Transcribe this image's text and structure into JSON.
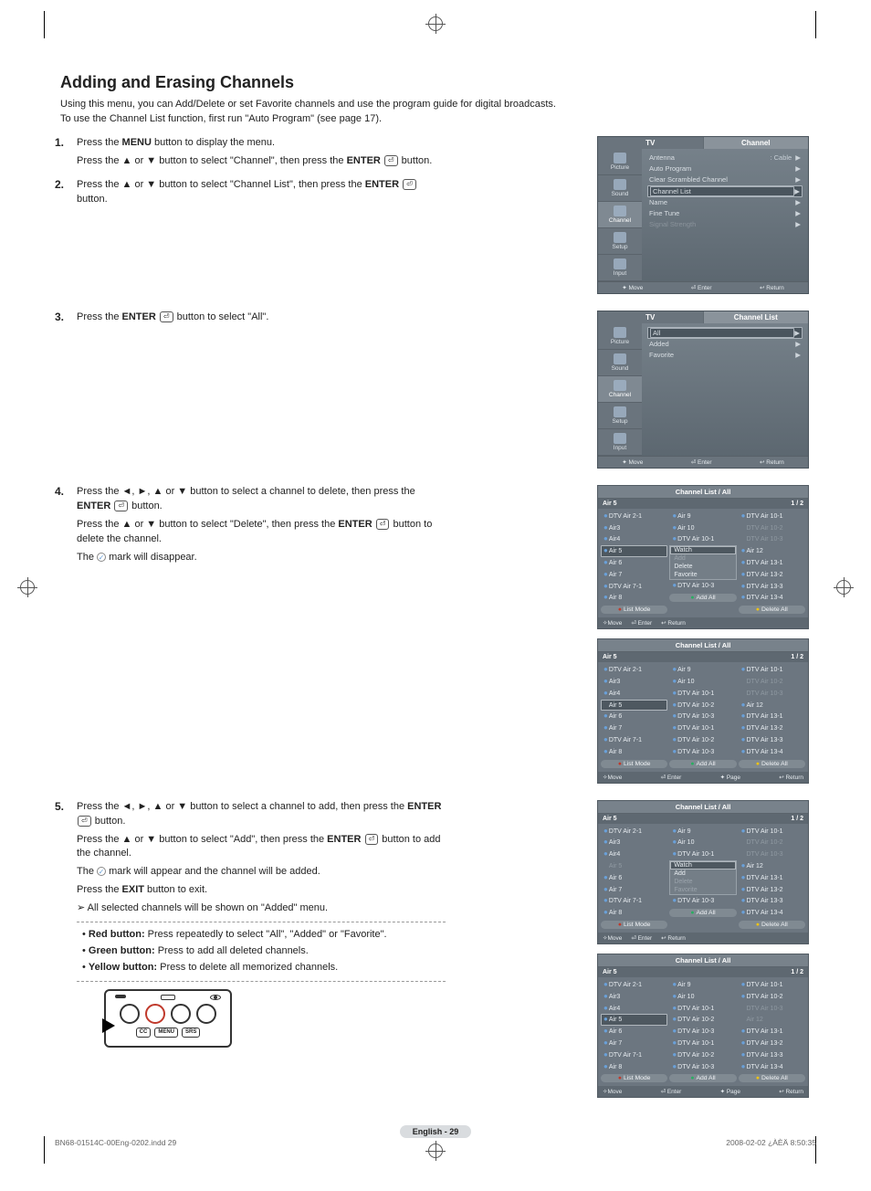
{
  "title": "Adding and Erasing Channels",
  "intro_l1": "Using this menu, you can Add/Delete or set Favorite channels and use the program guide for digital broadcasts.",
  "intro_l2": "To use the Channel List function, first run \"Auto Program\" (see page 17).",
  "steps": {
    "s1a": "Press the ",
    "s1b": "MENU",
    "s1c": " button to display the menu.",
    "s1d": "Press the ▲ or ▼ button to select \"Channel\", then press the ",
    "s1e": "ENTER",
    "s1f": " button.",
    "s2a": "Press the ▲ or ▼ button to select \"Channel List\", then press the ",
    "s2b": "ENTER",
    "s2c": " button.",
    "s3a": "Press the ",
    "s3b": "ENTER",
    "s3c": " button to select \"All\".",
    "s4a": "Press the  ◄, ►, ▲ or ▼ button to select a channel to delete, then press the ",
    "s4b": "ENTER",
    "s4c": " button.",
    "s4d": "Press the ▲ or ▼ button to select \"Delete\", then press the ",
    "s4e": "ENTER",
    "s4f": " button to delete the channel.",
    "s4g": "The ",
    "s4h": " mark will disappear.",
    "s5a": "Press the ◄, ►, ▲ or ▼ button to select a channel to add, then press the ",
    "s5b": "ENTER",
    "s5c": " button.",
    "s5d": "Press the ▲ or ▼ button to select \"Add\", then press the ",
    "s5e": "ENTER",
    "s5f": " button to add the channel.",
    "s5g": "The ",
    "s5h": " mark will appear and the channel will be added.",
    "s5i": "Press the ",
    "s5j": "EXIT",
    "s5k": " button to exit.",
    "note": "All selected channels will be shown on \"Added\" menu.",
    "red": "Red button:",
    "red_t": " Press repeatedly to select \"All\", \"Added\" or \"Favorite\".",
    "green": "Green button:",
    "green_t": " Press to add all deleted channels.",
    "yellow": "Yellow button:",
    "yellow_t": " Press to delete all memorized channels."
  },
  "osd1": {
    "tab_tv": "TV",
    "tab_channel": "Channel",
    "side": [
      "Picture",
      "Sound",
      "Channel",
      "Setup",
      "Input"
    ],
    "rows": [
      {
        "label": "Antenna",
        "val": ": Cable"
      },
      {
        "label": "Auto Program"
      },
      {
        "label": "Clear Scrambled Channel"
      },
      {
        "label": "Channel List",
        "sel": true
      },
      {
        "label": "Name"
      },
      {
        "label": "Fine Tune"
      },
      {
        "label": "Signal Strength",
        "dim": true
      }
    ],
    "footer": [
      "✦ Move",
      "⏎ Enter",
      "↩ Return"
    ]
  },
  "osd2": {
    "tab_tv": "TV",
    "tab_channel": "Channel List",
    "side": [
      "Picture",
      "Sound",
      "Channel",
      "Setup",
      "Input"
    ],
    "rows": [
      {
        "label": "All",
        "sel": true
      },
      {
        "label": "Added"
      },
      {
        "label": "Favorite"
      }
    ],
    "footer": [
      "✦ Move",
      "⏎ Enter",
      "↩ Return"
    ]
  },
  "chlist_common": {
    "title": "Channel List / All",
    "current": "Air 5",
    "page": "1 / 2",
    "list_mode": "List Mode",
    "add_all": "Add All",
    "delete_all": "Delete All"
  },
  "cl1": {
    "col1": [
      {
        "t": "DTV Air 2-1",
        "d": 1
      },
      {
        "t": "Air3",
        "d": 1
      },
      {
        "t": "Air4",
        "d": 1
      },
      {
        "t": "Air 5",
        "d": 1,
        "sel": 1
      },
      {
        "t": "Air 6",
        "d": 1
      },
      {
        "t": "Air 7",
        "d": 1
      },
      {
        "t": "DTV Air 7-1",
        "d": 1
      },
      {
        "t": "Air 8",
        "d": 1
      }
    ],
    "col2": [
      {
        "t": "Air 9",
        "d": 1
      },
      {
        "t": "Air 10",
        "d": 1
      },
      {
        "t": "DTV Air 10-1",
        "d": 1
      },
      {
        "t": "Watch",
        "pop": 1,
        "sel": 1
      },
      {
        "t": "Add",
        "pop": 1,
        "dim": 1
      },
      {
        "t": "Delete",
        "pop": 1
      },
      {
        "t": "Favorite",
        "pop": 1
      },
      {
        "t": "DTV Air 10-3",
        "d": 1
      }
    ],
    "col3": [
      {
        "t": "DTV Air 10-1",
        "d": 1
      },
      {
        "t": "DTV Air 10-2",
        "dim": 1
      },
      {
        "t": "DTV Air 10-3",
        "dim": 1
      },
      {
        "t": "Air 12",
        "d": 1
      },
      {
        "t": "DTV Air 13-1",
        "d": 1
      },
      {
        "t": "DTV Air 13-2",
        "d": 1
      },
      {
        "t": "DTV Air 13-3",
        "d": 1
      },
      {
        "t": "DTV Air 13-4",
        "d": 1
      }
    ],
    "footer": [
      "✧Move",
      "⏎ Enter",
      "↩ Return"
    ]
  },
  "cl2": {
    "col1": [
      {
        "t": "DTV Air 2-1",
        "d": 1
      },
      {
        "t": "Air3",
        "d": 1
      },
      {
        "t": "Air4",
        "d": 1
      },
      {
        "t": "Air 5",
        "sel": 1
      },
      {
        "t": "Air 6",
        "d": 1
      },
      {
        "t": "Air 7",
        "d": 1
      },
      {
        "t": "DTV Air 7-1",
        "d": 1
      },
      {
        "t": "Air 8",
        "d": 1
      }
    ],
    "col2": [
      {
        "t": "Air 9",
        "d": 1
      },
      {
        "t": "Air 10",
        "d": 1
      },
      {
        "t": "DTV Air 10-1",
        "d": 1
      },
      {
        "t": "DTV Air 10-2",
        "d": 1
      },
      {
        "t": "DTV Air 10-3",
        "d": 1
      },
      {
        "t": "DTV Air 10-1",
        "d": 1
      },
      {
        "t": "DTV Air 10-2",
        "d": 1
      },
      {
        "t": "DTV Air 10-3",
        "d": 1
      }
    ],
    "col3": [
      {
        "t": "DTV Air 10-1",
        "d": 1
      },
      {
        "t": "DTV Air 10-2",
        "dim": 1
      },
      {
        "t": "DTV Air 10-3",
        "dim": 1
      },
      {
        "t": "Air 12",
        "d": 1
      },
      {
        "t": "DTV Air 13-1",
        "d": 1
      },
      {
        "t": "DTV Air 13-2",
        "d": 1
      },
      {
        "t": "DTV Air 13-3",
        "d": 1
      },
      {
        "t": "DTV Air 13-4",
        "d": 1
      }
    ],
    "footer": [
      "✧Move",
      "⏎ Enter",
      "✦ Page",
      "↩ Return"
    ]
  },
  "cl3": {
    "col1": [
      {
        "t": "DTV Air 2-1",
        "d": 1
      },
      {
        "t": "Air3",
        "d": 1
      },
      {
        "t": "Air4",
        "d": 1
      },
      {
        "t": "Air 5",
        "dim": 1
      },
      {
        "t": "Air 6",
        "d": 1
      },
      {
        "t": "Air 7",
        "d": 1
      },
      {
        "t": "DTV Air 7-1",
        "d": 1
      },
      {
        "t": "Air 8",
        "d": 1
      }
    ],
    "col2": [
      {
        "t": "Air 9",
        "d": 1
      },
      {
        "t": "Air 10",
        "d": 1
      },
      {
        "t": "DTV Air 10-1",
        "d": 1
      },
      {
        "t": "Watch",
        "pop": 1,
        "sel": 1
      },
      {
        "t": "Add",
        "pop": 1
      },
      {
        "t": "Delete",
        "pop": 1,
        "dim": 1
      },
      {
        "t": "Favorite",
        "pop": 1,
        "dim": 1
      },
      {
        "t": "DTV Air 10-3",
        "d": 1
      }
    ],
    "col3": [
      {
        "t": "DTV Air 10-1",
        "d": 1
      },
      {
        "t": "DTV Air 10-2",
        "dim": 1
      },
      {
        "t": "DTV Air 10-3",
        "dim": 1
      },
      {
        "t": "Air 12",
        "d": 1
      },
      {
        "t": "DTV Air 13-1",
        "d": 1
      },
      {
        "t": "DTV Air 13-2",
        "d": 1
      },
      {
        "t": "DTV Air 13-3",
        "d": 1
      },
      {
        "t": "DTV Air 13-4",
        "d": 1
      }
    ],
    "footer": [
      "✧Move",
      "⏎ Enter",
      "↩ Return"
    ]
  },
  "cl4": {
    "col1": [
      {
        "t": "DTV Air 2-1",
        "d": 1
      },
      {
        "t": "Air3",
        "d": 1
      },
      {
        "t": "Air4",
        "d": 1
      },
      {
        "t": "Air 5",
        "d": 1,
        "sel": 1
      },
      {
        "t": "Air 6",
        "d": 1
      },
      {
        "t": "Air 7",
        "d": 1
      },
      {
        "t": "DTV Air 7-1",
        "d": 1
      },
      {
        "t": "Air 8",
        "d": 1
      }
    ],
    "col2": [
      {
        "t": "Air 9",
        "d": 1
      },
      {
        "t": "Air 10",
        "d": 1
      },
      {
        "t": "DTV Air 10-1",
        "d": 1
      },
      {
        "t": "DTV Air 10-2",
        "d": 1
      },
      {
        "t": "DTV Air 10-3",
        "d": 1
      },
      {
        "t": "DTV Air 10-1",
        "d": 1
      },
      {
        "t": "DTV Air 10-2",
        "d": 1
      },
      {
        "t": "DTV Air 10-3",
        "d": 1
      }
    ],
    "col3": [
      {
        "t": "DTV Air 10-1",
        "d": 1
      },
      {
        "t": "DTV Air 10-2",
        "d": 1
      },
      {
        "t": "DTV Air 10-3",
        "dim": 1
      },
      {
        "t": "Air 12",
        "dim": 1
      },
      {
        "t": "DTV Air 13-1",
        "d": 1
      },
      {
        "t": "DTV Air 13-2",
        "d": 1
      },
      {
        "t": "DTV Air 13-3",
        "d": 1
      },
      {
        "t": "DTV Air 13-4",
        "d": 1
      }
    ],
    "footer": [
      "✧Move",
      "⏎ Enter",
      "✦ Page",
      "↩ Return"
    ]
  },
  "remote_labels": [
    "CC",
    "MENU",
    "SRS"
  ],
  "page_badge": "English - 29",
  "doc_footer_left": "BN68-01514C-00Eng-0202.indd   29",
  "doc_footer_right": "2008-02-02   ¿ÀÈÄ 8:50:35"
}
